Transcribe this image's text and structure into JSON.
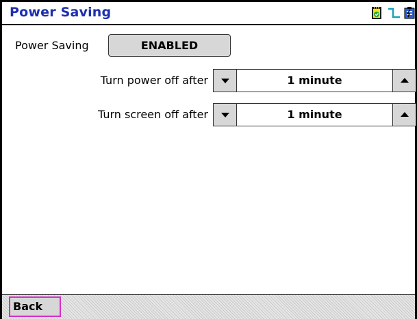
{
  "title": "Power Saving",
  "status_icons": [
    "sd-card-icon",
    "signal-icon",
    "power-battery-icon"
  ],
  "power_saving": {
    "label": "Power Saving",
    "value": "ENABLED"
  },
  "power_off": {
    "label": "Turn power off after",
    "value": "1 minute"
  },
  "screen_off": {
    "label": "Turn screen off after",
    "value": "1 minute"
  },
  "footer": {
    "back_label": "Back"
  },
  "colors": {
    "title": "#1c2fb0",
    "button": "#d7d7d7",
    "back_border": "#d62ec9"
  }
}
